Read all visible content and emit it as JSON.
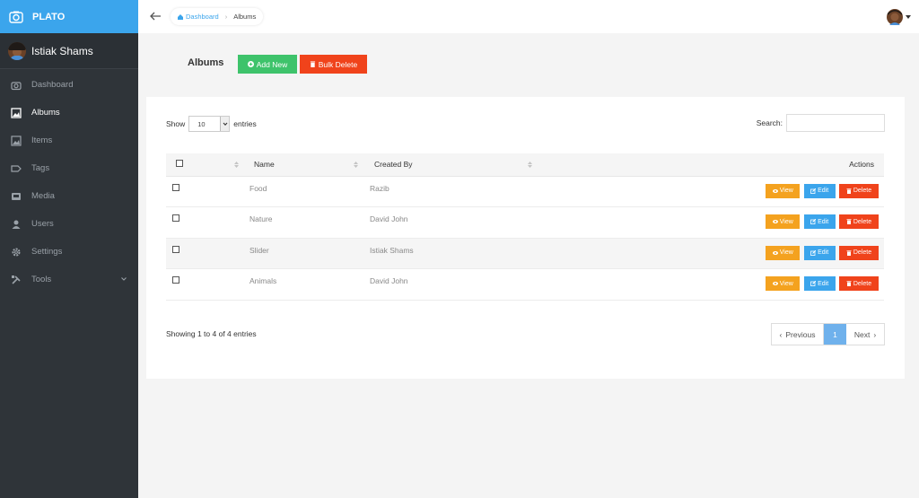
{
  "app": {
    "name": "PLATO"
  },
  "user": {
    "name": "Istiak Shams"
  },
  "sidebar": {
    "items": [
      {
        "label": "Dashboard",
        "icon": "camera-icon"
      },
      {
        "label": "Albums",
        "icon": "album-icon",
        "active": true
      },
      {
        "label": "Items",
        "icon": "image-icon"
      },
      {
        "label": "Tags",
        "icon": "tag-icon"
      },
      {
        "label": "Media",
        "icon": "media-icon"
      },
      {
        "label": "Users",
        "icon": "user-icon"
      },
      {
        "label": "Settings",
        "icon": "gear-icon"
      },
      {
        "label": "Tools",
        "icon": "tools-icon"
      }
    ]
  },
  "breadcrumb": {
    "home": "Dashboard",
    "current": "Albums"
  },
  "page": {
    "title": "Albums",
    "add_label": "Add New",
    "bulk_delete_label": "Bulk Delete"
  },
  "table_controls": {
    "show_label": "Show",
    "entries_value": "10",
    "entries_label": "entries",
    "search_label": "Search:"
  },
  "table": {
    "headers": {
      "name": "Name",
      "created_by": "Created By",
      "actions": "Actions"
    },
    "rows": [
      {
        "name": "Food",
        "created_by": "Razib"
      },
      {
        "name": "Nature",
        "created_by": "David John"
      },
      {
        "name": "Slider",
        "created_by": "Istiak Shams"
      },
      {
        "name": "Animals",
        "created_by": "David John"
      }
    ],
    "action_labels": {
      "view": "View",
      "edit": "Edit",
      "delete": "Delete"
    }
  },
  "footer": {
    "info": "Showing 1 to 4 of 4 entries",
    "prev": "Previous",
    "page": "1",
    "next": "Next"
  },
  "colors": {
    "brand": "#3ba5ec",
    "sidebar": "#2f3439",
    "success": "#3ec36b",
    "danger": "#f0431b",
    "warning": "#f4a21f"
  }
}
